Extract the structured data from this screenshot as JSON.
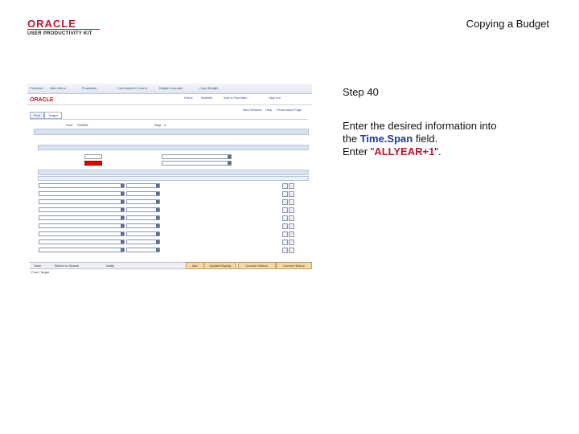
{
  "logo": {
    "brand": "ORACLE",
    "product": "USER PRODUCTIVITY KIT"
  },
  "document_title": "Copying a Budget",
  "step": {
    "title": "Step 40"
  },
  "instruction": {
    "line1": "Enter the desired information into",
    "line2_prefix": "the ",
    "field_name": "Time.Span",
    "line2_suffix": " field.",
    "line3_prefix": "Enter \"",
    "entry_value": "ALLYEAR+1",
    "line3_suffix": "\"."
  },
  "screenshot": {
    "nav_items": [
      "Favorites",
      "Main Menu",
      "Financials",
      "Commitment Control",
      "Budget Journals",
      "Copy Budget"
    ],
    "util_links": [
      "Home",
      "Worklist",
      "Add to Favorites",
      "Sign out"
    ],
    "page_links": [
      "New Window",
      "Help",
      "Personalize Page"
    ],
    "tabs": [
      "Pool",
      "Target"
    ],
    "labels": [
      "Pool:",
      "Step:"
    ],
    "pool_value": "SHARE",
    "step_value": "0",
    "bottom_links": [
      "Save",
      "Return to Search",
      "Notify"
    ],
    "bottom_buttons": [
      "Add",
      "Update/Display",
      "Include History",
      "Correct History"
    ],
    "footer_link": "Pool | Target"
  }
}
